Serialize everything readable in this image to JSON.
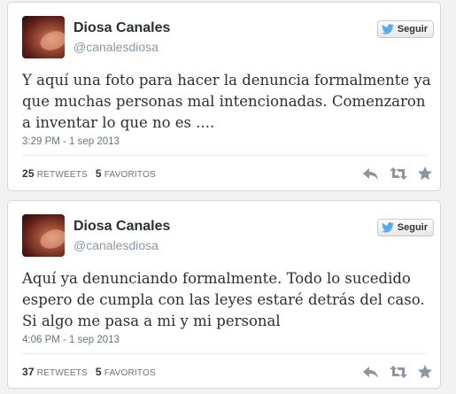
{
  "tweets": [
    {
      "name": "Diosa Canales",
      "handle": "@canalesdiosa",
      "follow_label": "Seguir",
      "text": "Y aquí una foto para hacer la denuncia formalmente  ya que muchas personas mal intencionadas. Comenzaron a inventar lo que no es ....",
      "timestamp": "3:29 PM - 1 sep 2013",
      "retweets_count": "25",
      "retweets_label": "RETWEETS",
      "favorites_count": "5",
      "favorites_label": "FAVORITOS"
    },
    {
      "name": "Diosa Canales",
      "handle": "@canalesdiosa",
      "follow_label": "Seguir",
      "text": "Aquí ya denunciando formalmente. Todo lo sucedido espero de cumpla con las leyes estaré detrás del caso. Si algo me pasa a mi y mi personal",
      "timestamp": "4:06 PM - 1 sep 2013",
      "retweets_count": "37",
      "retweets_label": "RETWEETS",
      "favorites_count": "5",
      "favorites_label": "FAVORITOS"
    }
  ],
  "colors": {
    "twitter_blue": "#55acee",
    "action_gray": "#8d969e"
  },
  "icons": [
    "twitter-bird-icon",
    "reply-icon",
    "retweet-icon",
    "favorite-star-icon"
  ]
}
